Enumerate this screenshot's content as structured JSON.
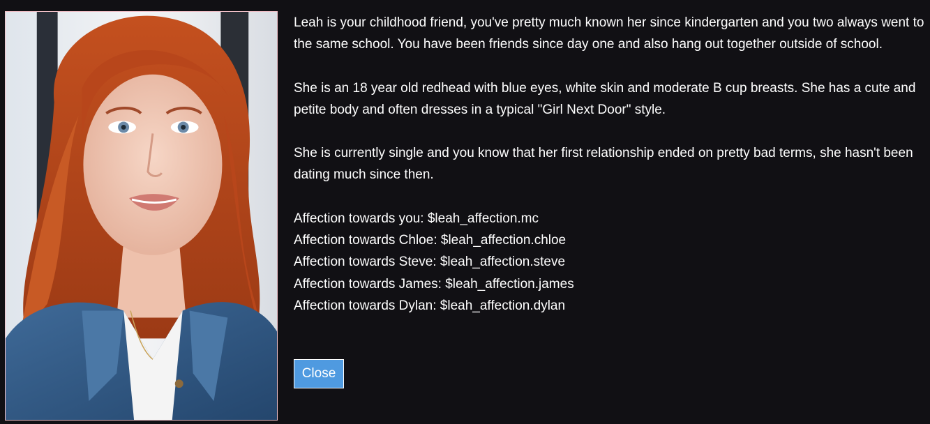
{
  "character": {
    "portrait_icon": "portrait-image",
    "paragraphs": [
      "Leah is your childhood friend, you've pretty much known her since kindergarten and you two always went to the same school. You have been friends since day one and also hang out together outside of school.",
      "She is an 18 year old redhead with blue eyes, white skin and moderate B cup breasts. She has a cute and petite body and often dresses in a typical \"Girl Next Door\" style.",
      "She is currently single and you know that her first relationship ended on pretty bad terms, she hasn't been dating much since then."
    ],
    "stats": [
      "Affection towards you: $leah_affection.mc",
      "Affection towards Chloe: $leah_affection.chloe",
      "Affection towards Steve: $leah_affection.steve",
      "Affection towards James: $leah_affection.james",
      "Affection towards Dylan: $leah_affection.dylan"
    ]
  },
  "actions": {
    "close_label": "Close"
  },
  "colors": {
    "background": "#111014",
    "button": "#4f9ae0",
    "portrait_border": "#f0c0c8"
  }
}
